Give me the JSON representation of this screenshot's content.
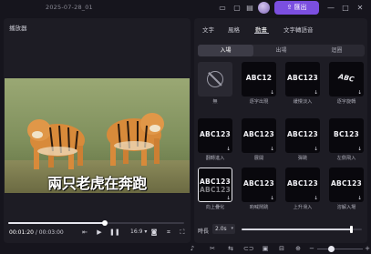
{
  "window": {
    "title": "2025-07-28_01",
    "export_label": "匯出",
    "icons": [
      "project-icon",
      "monitor-icon",
      "message-icon",
      "document-icon",
      "avatar",
      "export-icon",
      "minimize-icon",
      "maximize-icon",
      "close-icon"
    ]
  },
  "player": {
    "label": "播放器",
    "caption": "兩只老虎在奔跑",
    "current_time": "00:01:20",
    "separator": " / ",
    "total_time": "00:03:00",
    "progress": 0.55,
    "aspect_ratio": "16:9",
    "controls": [
      "trim-icon",
      "play-icon",
      "pause-icon",
      "snapshot-icon",
      "crop-icon",
      "fullscreen-icon"
    ]
  },
  "panel": {
    "tabs": [
      "文字",
      "風格",
      "動畫",
      "文字轉語音"
    ],
    "active_tab": 2,
    "subtabs": [
      "入場",
      "出場",
      "迴圈"
    ],
    "active_subtab": 0,
    "effects": [
      {
        "name": "無",
        "preview": "",
        "none": true
      },
      {
        "name": "逐字出現",
        "preview": "ABC12"
      },
      {
        "name": "緩慢淡入",
        "preview": "ABC123"
      },
      {
        "name": "逐字旋轉",
        "preview": "ABC"
      },
      {
        "name": "翻轉進入",
        "preview": "ABC123"
      },
      {
        "name": "展開",
        "preview": "ABC123"
      },
      {
        "name": "彈跳",
        "preview": "ABC123"
      },
      {
        "name": "左側飛入",
        "preview": "BC123"
      },
      {
        "name": "向上疊化",
        "preview": "ABC123",
        "selected": true
      },
      {
        "name": "吶喊鬧跳",
        "preview": "ABC123"
      },
      {
        "name": "上升滑入",
        "preview": "ABC123"
      },
      {
        "name": "溶解入場",
        "preview": "ABC123"
      }
    ],
    "duration": {
      "label": "時長",
      "value": "2.0s",
      "level": 0.91
    }
  },
  "bottombar": {
    "icons": [
      "microphone-icon",
      "scissors-icon",
      "split-icon",
      "link-icon",
      "group-icon",
      "zoom-out-icon",
      "zoom-in-icon"
    ],
    "zoom_level": 0.3
  }
}
